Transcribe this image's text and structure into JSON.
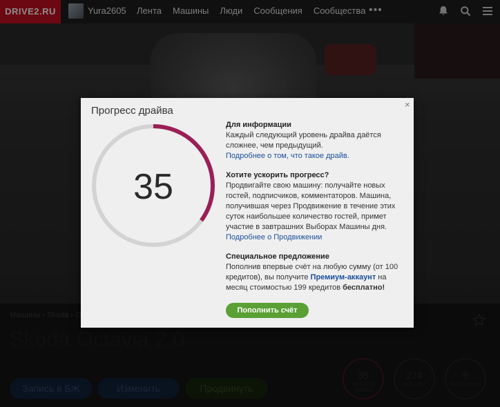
{
  "header": {
    "logo": "DRIVE2.RU",
    "username": "Yura2605",
    "nav": [
      "Лента",
      "Машины",
      "Люди",
      "Сообщения",
      "Сообщества"
    ],
    "more": "•••",
    "icons": [
      "bell-icon",
      "search-icon",
      "menu-icon"
    ]
  },
  "page": {
    "breadcrumb": "Машины › Skoda › Oc",
    "car_title": "Skoda Octavia 2.0",
    "buttons": [
      "Запись в БЖ",
      "Изменить",
      "Продвинуть"
    ],
    "stats": [
      {
        "value": "35",
        "label": "прогресс драйва"
      },
      {
        "value": "274",
        "label": "читателя"
      },
      {
        "value": "9",
        "label": "бортжурнал"
      }
    ]
  },
  "modal": {
    "title": "Прогресс драйва",
    "close": "×",
    "progress_value": "35",
    "progress_fraction": 0.35,
    "accent": "#9b1f56",
    "track_color": "#d3d3d3",
    "info": {
      "heading": "Для информации",
      "text": "Каждый следующий уровень драйва даётся сложнее, чем предыдущий.",
      "link": "Подробнее о том, что такое драйв."
    },
    "boost": {
      "heading": "Хотите ускорить прогресс?",
      "text": "Продвигайте свою машину: получайте новых гостей, подписчиков, комментаторов. Машина, получившая через Продвижение в течение этих суток наибольшее количество гостей, примет участие в завтрашних Выборах Машины дня.",
      "link": "Подробнее о Продвижении"
    },
    "offer": {
      "heading": "Специальное предложение",
      "text_before": "Пополнив впервые счёт на любую сумму (от 100 кредитов), вы получите ",
      "premium": "Премиум-аккаунт",
      "text_after": " на месяц стоимостью 199 кредитов ",
      "free": "бесплатно!"
    },
    "button": "Пополнить счёт"
  }
}
